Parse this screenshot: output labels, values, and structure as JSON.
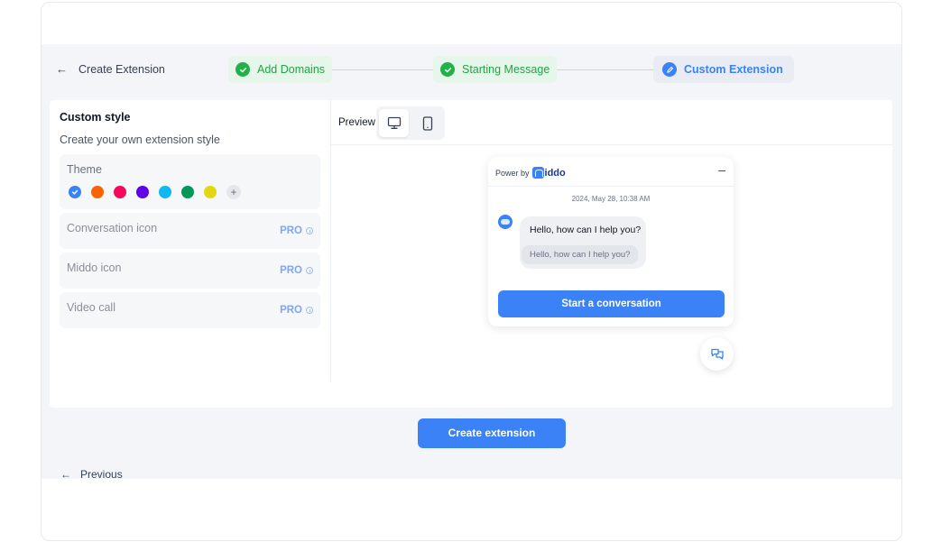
{
  "header": {
    "back_arrow": "←",
    "title": "Create Extension",
    "steps": [
      {
        "label": "Add Domains",
        "status": "done"
      },
      {
        "label": "Starting Message",
        "status": "done"
      },
      {
        "label": "Custom Extension",
        "status": "active"
      }
    ]
  },
  "left_panel": {
    "title": "Custom style",
    "subtitle": "Create your own extension style",
    "theme_label": "Theme",
    "theme_colors": [
      "#3b82f6",
      "#fa6400",
      "#f5095c",
      "#6200ea",
      "#0db9f0",
      "#039855",
      "#e3d80f"
    ],
    "selected_color_index": 0,
    "add_color_symbol": "+",
    "options": [
      {
        "label": "Conversation icon",
        "badge": "PRO"
      },
      {
        "label": "Middo icon",
        "badge": "PRO"
      },
      {
        "label": "Video call",
        "badge": "PRO"
      }
    ]
  },
  "preview": {
    "label": "Preview",
    "devices": [
      {
        "name": "desktop",
        "selected": true
      },
      {
        "name": "mobile",
        "selected": false
      }
    ]
  },
  "widget": {
    "power_by": "Power by",
    "logo_text": "iddo",
    "minimize_symbol": "–",
    "date": "2024, May 28, 10:38 AM",
    "message": "Hello, how can I help you?",
    "suggestion": "Hello, how can I help you?",
    "start_button": "Start a conversation"
  },
  "footer": {
    "prev_arrow": "←",
    "previous": "Previous",
    "create": "Create extension"
  },
  "colors": {
    "accent": "#3b82f6",
    "success": "#22b04b",
    "canvas": "#f3f5f8"
  }
}
